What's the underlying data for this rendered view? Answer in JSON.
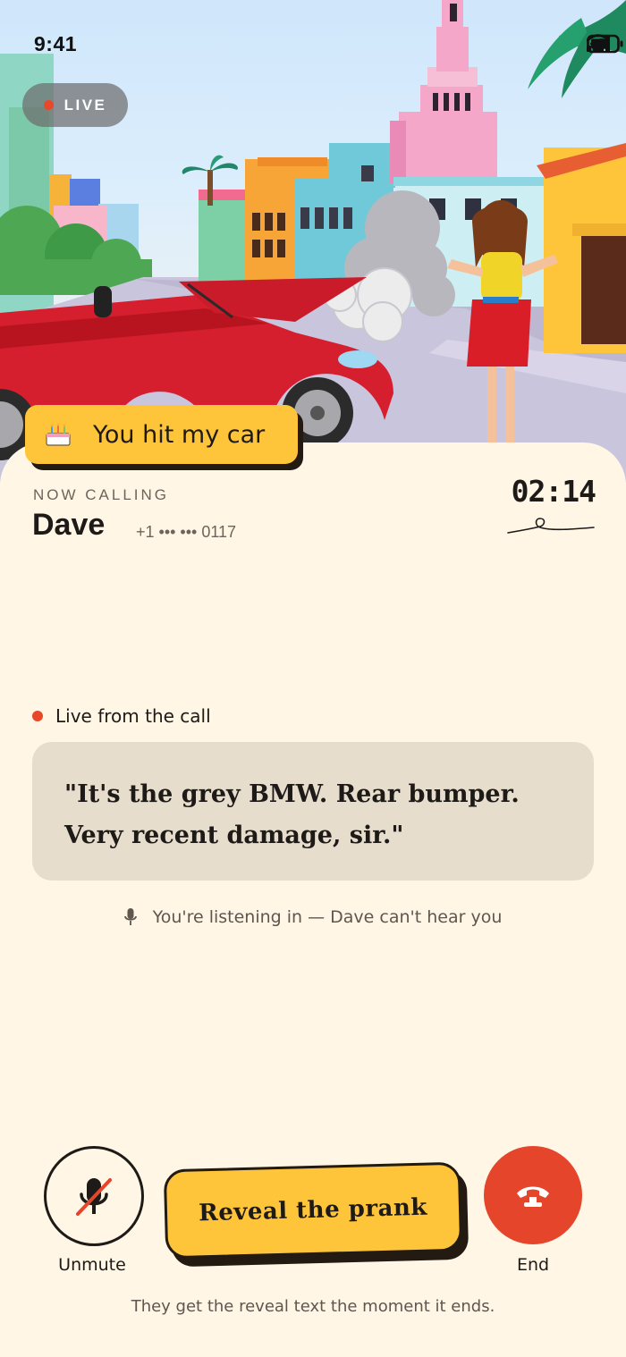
{
  "status_bar": {
    "time": "9:41",
    "icons": [
      "signal-icon",
      "wifi-icon",
      "battery-icon"
    ]
  },
  "live_badge": {
    "label": "LIVE"
  },
  "scenario": {
    "label": "You hit my car",
    "icon": "cake-icon"
  },
  "call": {
    "status_label": "NOW CALLING",
    "contact_name": "Dave",
    "contact_number": "+1 ••• ••• 0117",
    "timer": "02:14"
  },
  "transcript": {
    "section_label": "Live from the call",
    "quote": "\"It's the grey BMW. Rear bumper. Very recent damage, sir.\""
  },
  "listening_note": {
    "icon": "microphone-icon",
    "text": "You're listening in — Dave can't hear you"
  },
  "controls": {
    "mute_label": "Unmute",
    "reveal_label": "Reveal the prank",
    "end_label": "End"
  },
  "footer_note": "They get the reveal text the moment it ends.",
  "colors": {
    "background": "#FFF6E5",
    "accent_yellow": "#FFC53A",
    "end_red": "#E5462B",
    "live_red": "#E8472A",
    "quote_bg": "#E6DDCD"
  }
}
